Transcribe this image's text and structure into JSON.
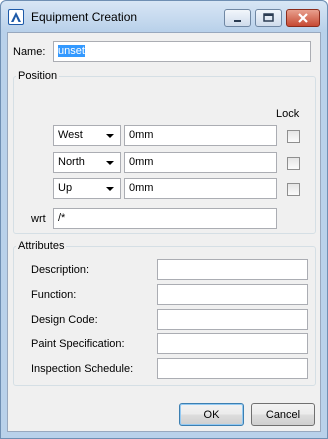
{
  "window": {
    "title": "Equipment Creation"
  },
  "name": {
    "label": "Name:",
    "value": "unset"
  },
  "position": {
    "title": "Position",
    "lock_label": "Lock",
    "rows": [
      {
        "direction": "West",
        "value": "0mm"
      },
      {
        "direction": "North",
        "value": "0mm"
      },
      {
        "direction": "Up",
        "value": "0mm"
      }
    ],
    "wrt_label": "wrt",
    "wrt_value": "/*"
  },
  "attributes": {
    "title": "Attributes",
    "fields": [
      {
        "label": "Description:",
        "value": ""
      },
      {
        "label": "Function:",
        "value": ""
      },
      {
        "label": "Design Code:",
        "value": ""
      },
      {
        "label": "Paint Specification:",
        "value": ""
      },
      {
        "label": "Inspection Schedule:",
        "value": ""
      }
    ]
  },
  "buttons": {
    "ok": "OK",
    "cancel": "Cancel"
  }
}
